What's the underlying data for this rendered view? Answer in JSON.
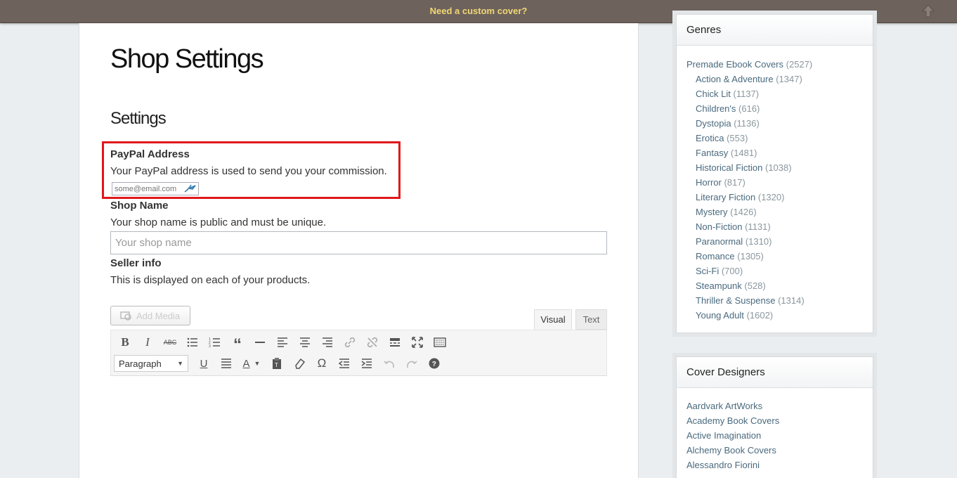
{
  "topbar": {
    "text": "Need a custom cover?"
  },
  "page": {
    "title": "Shop Settings",
    "section": "Settings"
  },
  "paypal": {
    "label": "PayPal Address",
    "description": "Your PayPal address is used to send you your commission.",
    "placeholder": "some@email.com"
  },
  "shop_name": {
    "label": "Shop Name",
    "description": "Your shop name is public and must be unique.",
    "placeholder": "Your shop name"
  },
  "seller_info": {
    "label": "Seller info",
    "description": "This is displayed on each of your products."
  },
  "editor": {
    "add_media": "Add Media",
    "tab_visual": "Visual",
    "tab_text": "Text",
    "format_select": "Paragraph"
  },
  "genres": {
    "title": "Genres",
    "items": [
      {
        "name": "Premade Ebook Covers",
        "count": "(2527)"
      },
      {
        "name": "Action & Adventure",
        "count": "(1347)"
      },
      {
        "name": "Chick Lit",
        "count": "(1137)"
      },
      {
        "name": "Children's",
        "count": "(616)"
      },
      {
        "name": "Dystopia",
        "count": "(1136)"
      },
      {
        "name": "Erotica",
        "count": "(553)"
      },
      {
        "name": "Fantasy",
        "count": "(1481)"
      },
      {
        "name": "Historical Fiction",
        "count": "(1038)"
      },
      {
        "name": "Horror",
        "count": "(817)"
      },
      {
        "name": "Literary Fiction",
        "count": "(1320)"
      },
      {
        "name": "Mystery",
        "count": "(1426)"
      },
      {
        "name": "Non-Fiction",
        "count": "(1131)"
      },
      {
        "name": "Paranormal",
        "count": "(1310)"
      },
      {
        "name": "Romance",
        "count": "(1305)"
      },
      {
        "name": "Sci-Fi",
        "count": "(700)"
      },
      {
        "name": "Steampunk",
        "count": "(528)"
      },
      {
        "name": "Thriller & Suspense",
        "count": "(1314)"
      },
      {
        "name": "Young Adult",
        "count": "(1602)"
      }
    ]
  },
  "designers": {
    "title": "Cover Designers",
    "items": [
      "Aardvark ArtWorks",
      "Academy Book Covers",
      "Active Imagination",
      "Alchemy Book Covers",
      "Alessandro Fiorini"
    ]
  },
  "colors": {
    "topbar_bg": "#6d625c",
    "topbar_text": "#f1d774",
    "highlight_border": "#e0181b",
    "link": "#4a6a7e"
  }
}
